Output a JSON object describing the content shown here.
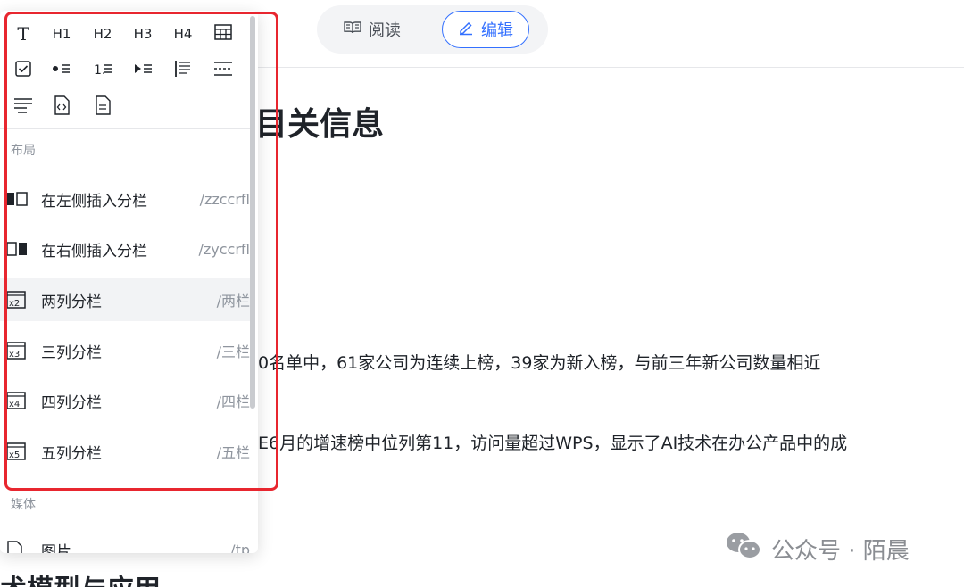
{
  "mode_switch": {
    "read_label": "阅读",
    "edit_label": "编辑"
  },
  "document": {
    "heading": "目关信息",
    "para1": "0名单中，61家公司为连续上榜，39家为新入榜，与前三年新公司数量相近",
    "para2": "E6月的增速榜中位列第11，访问量超过WPS，显示了AI技术在办公产品中的成",
    "heading2": "术模型与应用"
  },
  "watermark": {
    "text": "公众号 · 陌晨"
  },
  "toolbar": {
    "text_glyph": "T",
    "h1": "H1",
    "h2": "H2",
    "h3": "H3",
    "h4": "H4"
  },
  "sections": {
    "layout": "布局",
    "media": "媒体"
  },
  "layout_items": [
    {
      "label": "在左侧插入分栏",
      "shortcut": "/zzccrfl"
    },
    {
      "label": "在右侧插入分栏",
      "shortcut": "/zyccrfl"
    },
    {
      "label": "两列分栏",
      "shortcut": "/两栏",
      "badge": "x2"
    },
    {
      "label": "三列分栏",
      "shortcut": "/三栏",
      "badge": "x3"
    },
    {
      "label": "四列分栏",
      "shortcut": "/四栏",
      "badge": "x4"
    },
    {
      "label": "五列分栏",
      "shortcut": "/五栏",
      "badge": "x5"
    }
  ],
  "media_items": [
    {
      "label": "图片",
      "shortcut": "/tp"
    }
  ],
  "colors": {
    "accent": "#3370ff",
    "highlight_box": "#e8262f"
  }
}
